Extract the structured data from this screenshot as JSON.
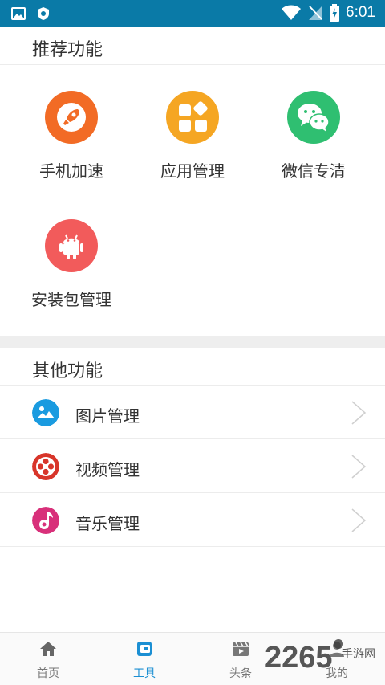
{
  "status_bar": {
    "time": "6:01",
    "icons": [
      "image-icon",
      "shield-icon",
      "wifi-icon",
      "no-sim-icon",
      "battery-charging-icon"
    ]
  },
  "recommended": {
    "title": "推荐功能",
    "items": [
      {
        "label": "手机加速",
        "icon": "rocket-icon",
        "color": "#f26b25"
      },
      {
        "label": "应用管理",
        "icon": "apps-icon",
        "color": "#f5a623"
      },
      {
        "label": "微信专清",
        "icon": "wechat-icon",
        "color": "#2fbf71"
      },
      {
        "label": "安装包管理",
        "icon": "android-icon",
        "color": "#f25b5b"
      }
    ]
  },
  "other": {
    "title": "其他功能",
    "items": [
      {
        "label": "图片管理",
        "icon": "picture-icon",
        "color": "#1a9be0"
      },
      {
        "label": "视频管理",
        "icon": "video-reel-icon",
        "color": "#d8352a"
      },
      {
        "label": "音乐管理",
        "icon": "music-note-icon",
        "color": "#d8307a"
      }
    ]
  },
  "bottom_nav": {
    "items": [
      {
        "label": "首页",
        "icon": "home-icon",
        "active": false
      },
      {
        "label": "工具",
        "icon": "tools-icon",
        "active": true
      },
      {
        "label": "头条",
        "icon": "headline-icon",
        "active": false
      },
      {
        "label": "我的",
        "icon": "profile-icon",
        "active": false
      }
    ],
    "active_color": "#1b8fd3"
  },
  "watermark": {
    "number": "2265",
    "text": "手游网"
  }
}
